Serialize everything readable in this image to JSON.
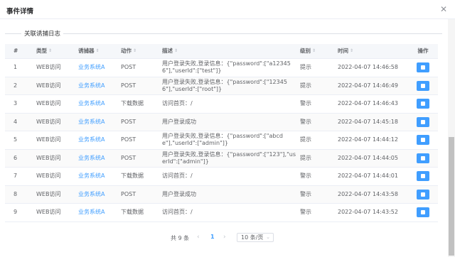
{
  "dialog": {
    "title": "事件详情",
    "close_icon": "close-icon"
  },
  "section": {
    "legend": "关联诱捕日志"
  },
  "table": {
    "headers": {
      "index": "#",
      "type": "类型",
      "trap": "诱捕器",
      "action": "动作",
      "desc": "描述",
      "level": "级别",
      "time": "时间",
      "op": "操作"
    },
    "rows": [
      {
        "index": "1",
        "type": "WEB访问",
        "trap": "业务系统A",
        "action": "POST",
        "desc": "用户登录失败,登录信息：{\"password\":[\"a123456\"],\"userId\":[\"test\"]}",
        "level": "提示",
        "time": "2022-04-07 14:46:58"
      },
      {
        "index": "2",
        "type": "WEB访问",
        "trap": "业务系统A",
        "action": "POST",
        "desc": "用户登录失败,登录信息：{\"password\":[\"123456\"],\"userId\":[\"root\"]}",
        "level": "提示",
        "time": "2022-04-07 14:46:49"
      },
      {
        "index": "3",
        "type": "WEB访问",
        "trap": "业务系统A",
        "action": "下载数据",
        "desc": "访问首页：/",
        "level": "警示",
        "time": "2022-04-07 14:46:43"
      },
      {
        "index": "4",
        "type": "WEB访问",
        "trap": "业务系统A",
        "action": "POST",
        "desc": "用户登录成功",
        "level": "警示",
        "time": "2022-04-07 14:45:18"
      },
      {
        "index": "5",
        "type": "WEB访问",
        "trap": "业务系统A",
        "action": "POST",
        "desc": "用户登录失败,登录信息：{\"password\":[\"abcde\"],\"userId\":[\"admin\"]}",
        "level": "提示",
        "time": "2022-04-07 14:44:12"
      },
      {
        "index": "6",
        "type": "WEB访问",
        "trap": "业务系统A",
        "action": "POST",
        "desc": "用户登录失败,登录信息：{\"password\":[\"123\"],\"userId\":[\"admin\"]}",
        "level": "提示",
        "time": "2022-04-07 14:44:05"
      },
      {
        "index": "7",
        "type": "WEB访问",
        "trap": "业务系统A",
        "action": "下载数据",
        "desc": "访问首页：/",
        "level": "警示",
        "time": "2022-04-07 14:44:01"
      },
      {
        "index": "8",
        "type": "WEB访问",
        "trap": "业务系统A",
        "action": "POST",
        "desc": "用户登录成功",
        "level": "警示",
        "time": "2022-04-07 14:43:58"
      },
      {
        "index": "9",
        "type": "WEB访问",
        "trap": "业务系统A",
        "action": "下载数据",
        "desc": "访问首页：/",
        "level": "警示",
        "time": "2022-04-07 14:43:52"
      }
    ]
  },
  "pagination": {
    "total": "共 9 条",
    "current": "1",
    "page_size": "10 条/页"
  },
  "colors": {
    "accent": "#409eff",
    "header_bg": "#f5f7fa"
  }
}
